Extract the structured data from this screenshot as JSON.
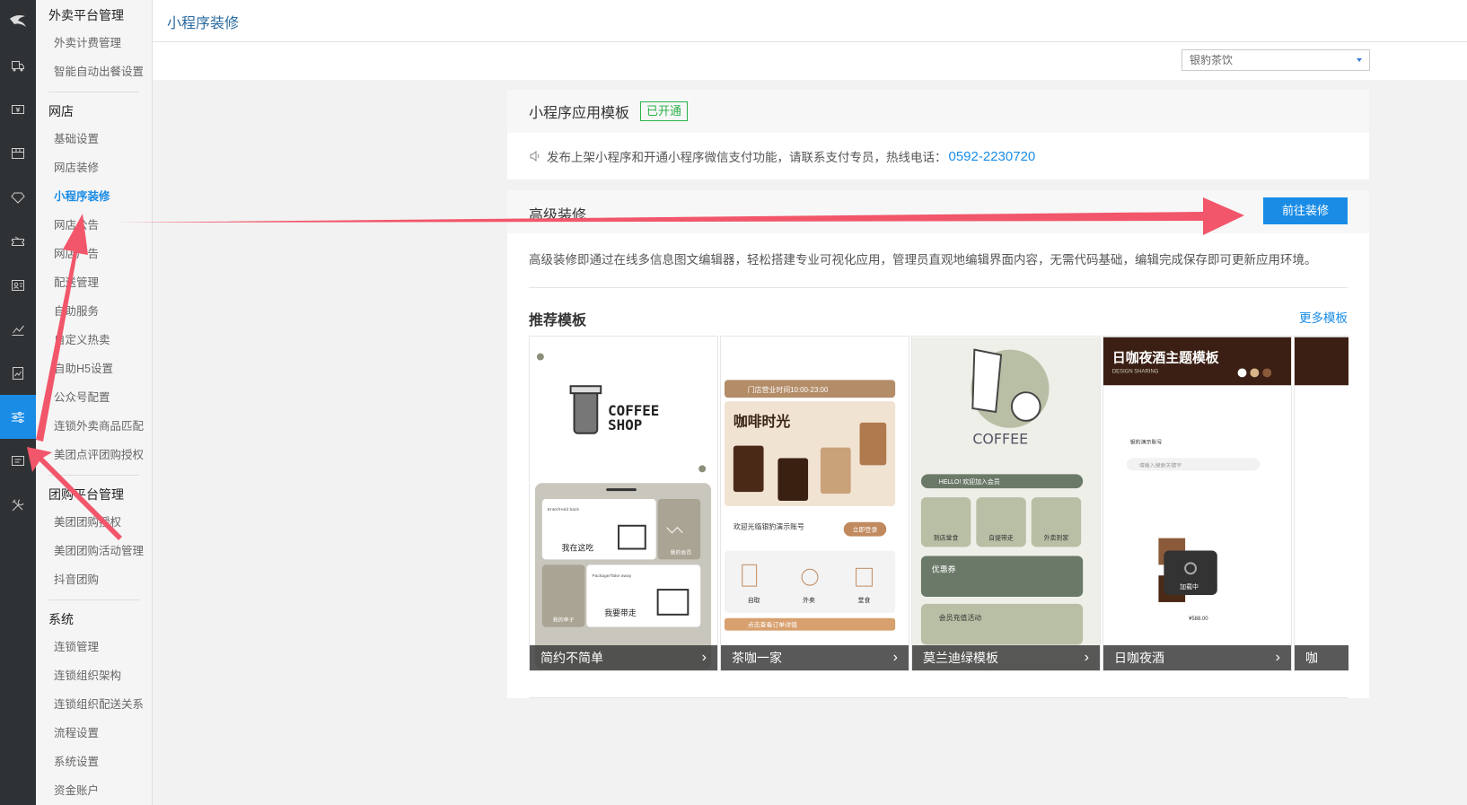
{
  "header": {
    "page_title": "小程序装修"
  },
  "shop_select": {
    "value": "银豹茶饮"
  },
  "sidebar": {
    "groups": [
      {
        "title": "外卖平台管理",
        "items": [
          "外卖计费管理",
          "智能自动出餐设置"
        ]
      },
      {
        "title": "网店",
        "items": [
          "基础设置",
          "网店装修",
          "小程序装修",
          "网店公告",
          "网店广告",
          "配送管理",
          "自助服务",
          "自定义热卖",
          "自助H5设置",
          "公众号配置",
          "连锁外卖商品匹配",
          "美团点评团购授权"
        ]
      },
      {
        "title": "团购平台管理",
        "items": [
          "美团团购授权",
          "美团团购活动管理",
          "抖音团购"
        ]
      },
      {
        "title": "系统",
        "items": [
          "连锁管理",
          "连锁组织架构",
          "连锁组织配送关系",
          "流程设置",
          "系统设置",
          "资金账户"
        ]
      }
    ],
    "active_item": "小程序装修"
  },
  "rail_icons": [
    "logo-icon",
    "truck-icon",
    "cashier-icon",
    "box-icon",
    "diamond-icon",
    "coupon-icon",
    "member-card-icon",
    "chart-icon",
    "report-icon",
    "settings-sliders-icon",
    "message-icon",
    "tools-icon"
  ],
  "template_panel": {
    "title": "小程序应用模板",
    "badge": "已开通",
    "notice_text": "发布上架小程序和开通小程序微信支付功能，请联系支付专员，热线电话：",
    "phone": "0592-2230720"
  },
  "advanced_panel": {
    "title": "高级装修",
    "go_button": "前往装修",
    "description": "高级装修即通过在线多信息图文编辑器，轻松搭建专业可视化应用，管理员直观地编辑界面内容，无需代码基础，编辑完成保存即可更新应用环境。",
    "recommend_title": "推荐模板",
    "more_link": "更多模板",
    "templates": [
      {
        "name": "简约不简单"
      },
      {
        "name": "茶咖一家"
      },
      {
        "name": "莫兰迪绿模板"
      },
      {
        "name": "日咖夜酒"
      },
      {
        "name": "咖"
      }
    ]
  },
  "template_art": {
    "coffee_shop": {
      "logo_line1": "COFFEE",
      "logo_line2": "SHOP",
      "dine_in_en": "Enter/Hold back",
      "dine_in": "我在这吃",
      "takeout_en": "Package/Take away",
      "takeout": "我要带走",
      "member": "我的会员",
      "order": "我的单子"
    },
    "tea_coffee": {
      "hours": "门店营业时间10:00-23:00",
      "banner": "咖啡时光",
      "welcome": "欢迎光临银豹演示账号",
      "login": "立即登录",
      "tabs": [
        "自取",
        "外卖",
        "堂食"
      ],
      "order_link": "点击查看订单详情"
    },
    "morandi": {
      "brand": "COFFEE",
      "hello": "HELLO! 欢迎加入会员",
      "tiles": [
        "到店堂食",
        "自提带走",
        "外卖到家"
      ],
      "coupon": "优惠券",
      "recharge": "会员充值活动"
    },
    "day_night": {
      "title": "日咖夜酒主题模板",
      "subtitle": "DESIGN SHARING",
      "account": "银豹演示账号",
      "search": "请输入搜索关键字",
      "loading": "加载中",
      "price": "¥588.00"
    }
  },
  "colors": {
    "accent": "#1a8ce6",
    "rail": "#2f3235",
    "annotation_arrow": "#f2566a",
    "success": "#2bb24c"
  }
}
